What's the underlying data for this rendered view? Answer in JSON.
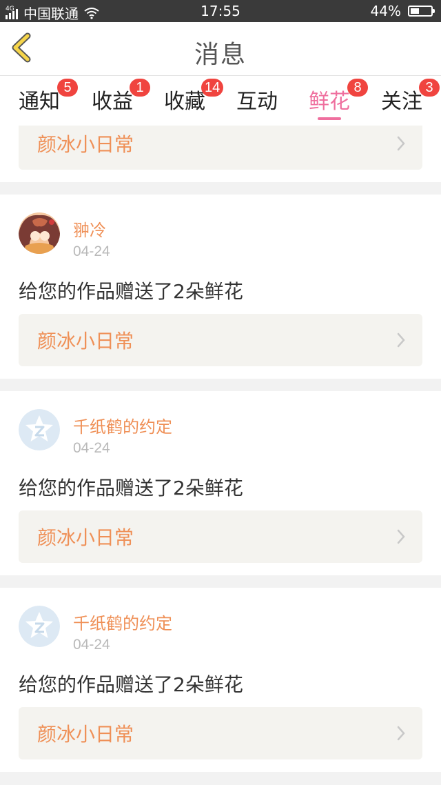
{
  "status_bar": {
    "network": "4G",
    "carrier": "中国联通",
    "time": "17:55",
    "battery": "44%",
    "battery_level": 0.44
  },
  "header": {
    "title": "消息",
    "back_icon": "chevron-left-icon"
  },
  "tabs": [
    {
      "label": "通知",
      "badge": "5"
    },
    {
      "label": "收益",
      "badge": "1"
    },
    {
      "label": "收藏",
      "badge": "14"
    },
    {
      "label": "互动",
      "badge": ""
    },
    {
      "label": "鲜花",
      "badge": "8",
      "active": true
    },
    {
      "label": "关注",
      "badge": "3"
    }
  ],
  "messages": [
    {
      "work": "颜冰小日常"
    },
    {
      "user": "翀冷",
      "date": "04-24",
      "text": "给您的作品赠送了2朵鲜花",
      "work": "颜冰小日常",
      "avatar": "anime-avatar"
    },
    {
      "user": "千纸鹤的约定",
      "date": "04-24",
      "text": "给您的作品赠送了2朵鲜花",
      "work": "颜冰小日常",
      "avatar": "qq-default-avatar"
    },
    {
      "user": "千纸鹤的约定",
      "date": "04-24",
      "text": "给您的作品赠送了2朵鲜花",
      "work": "颜冰小日常",
      "avatar": "qq-default-avatar"
    }
  ],
  "colors": {
    "accent": "#ef6f9e",
    "name_color": "#ef9057",
    "badge": "#f0443f",
    "back_icon_fill": "#f6d54a"
  }
}
